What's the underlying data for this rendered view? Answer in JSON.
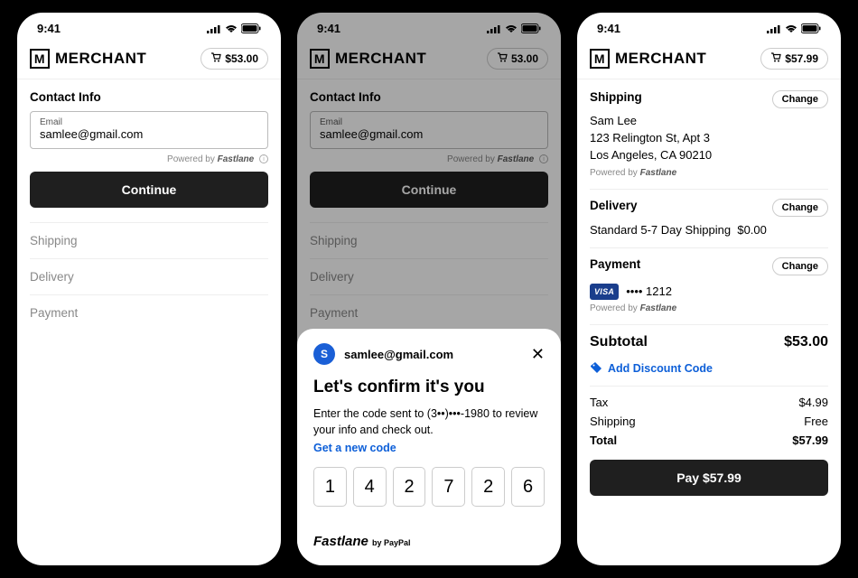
{
  "status_time": "9:41",
  "merchant": "MERCHANT",
  "screens": {
    "a": {
      "cart_total": "$53.00",
      "contact_title": "Contact Info",
      "email_label": "Email",
      "email_value": "samlee@gmail.com",
      "powered": "Powered by",
      "powered_brand": "Fastlane",
      "continue": "Continue",
      "steps": [
        "Shipping",
        "Delivery",
        "Payment"
      ]
    },
    "b": {
      "cart_total": "53.00",
      "contact_title": "Contact Info",
      "email_label": "Email",
      "email_value": "samlee@gmail.com",
      "powered": "Powered by",
      "powered_brand": "Fastlane",
      "continue": "Continue",
      "steps": [
        "Shipping",
        "Delivery",
        "Payment"
      ],
      "sheet": {
        "avatar": "S",
        "email": "samlee@gmail.com",
        "title": "Let's confirm it's you",
        "body": "Enter the code sent to (3••)•••-1980 to review your info and check out.",
        "link": "Get a new code",
        "otp": [
          "1",
          "4",
          "2",
          "7",
          "2",
          "6"
        ],
        "brand_main": "Fastlane",
        "brand_sub": "by PayPal"
      }
    },
    "c": {
      "cart_total": "$57.99",
      "shipping": {
        "title": "Shipping",
        "change": "Change",
        "name": "Sam Lee",
        "line1": "123 Relington St, Apt 3",
        "line2": "Los Angeles, CA 90210",
        "powered": "Powered by",
        "powered_brand": "Fastlane"
      },
      "delivery": {
        "title": "Delivery",
        "change": "Change",
        "text": "Standard 5-7 Day Shipping",
        "price": "$0.00"
      },
      "payment": {
        "title": "Payment",
        "change": "Change",
        "brand": "VISA",
        "last4": "•••• 1212",
        "powered": "Powered by",
        "powered_brand": "Fastlane"
      },
      "subtotal_label": "Subtotal",
      "subtotal": "$53.00",
      "discount": "Add Discount Code",
      "tax_label": "Tax",
      "tax": "$4.99",
      "ship_label": "Shipping",
      "ship": "Free",
      "total_label": "Total",
      "total": "$57.99",
      "pay_btn": "Pay $57.99"
    }
  }
}
